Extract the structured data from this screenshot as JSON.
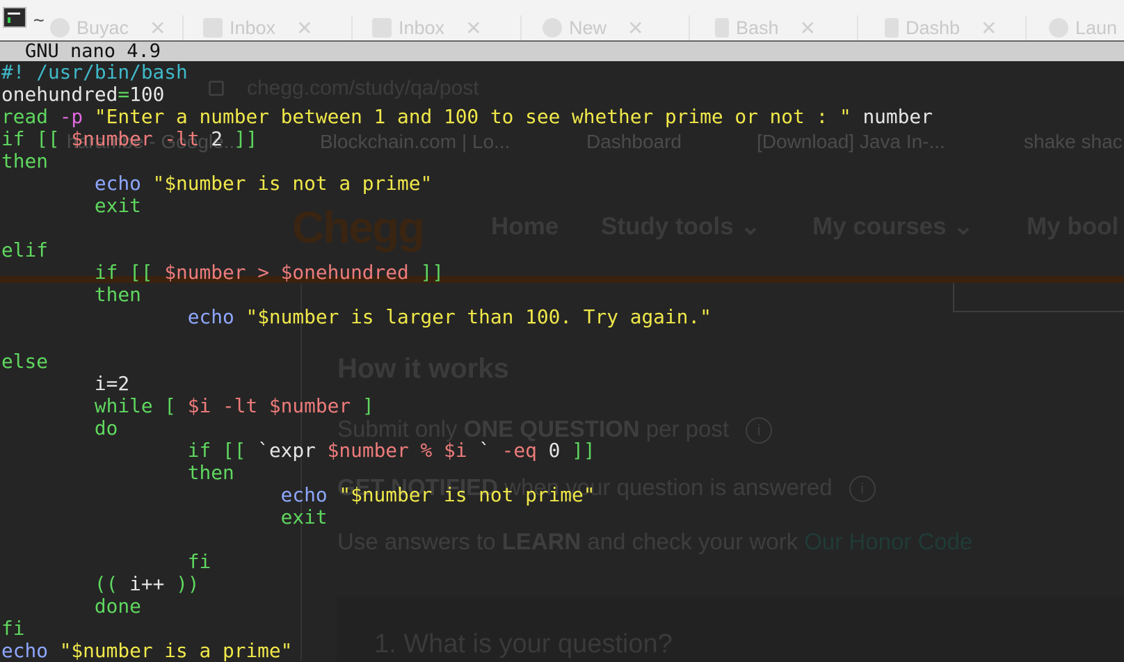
{
  "browser_ghost": {
    "tabs": [
      "Buyac",
      "Inbox",
      "Inbox",
      "New",
      "Bash",
      "Dashb",
      "Laun"
    ],
    "address": "chegg.com/study/qa/post",
    "bookmarks": [
      "harambe - Google...",
      "Blockchain.com | Lo...",
      "Dashboard",
      "[Download] Java In-...",
      "shake shac"
    ],
    "logo": "Chegg",
    "nav": [
      "Home",
      "Study tools",
      "My courses",
      "My bool"
    ],
    "section_title": "How it works",
    "bullets": {
      "b1_pre": "Submit only ",
      "b1_bold": "ONE QUESTION",
      "b1_post": " per post",
      "b2_bold": "GET NOTIFIED",
      "b2_post": " when your question is answered",
      "b3_pre": "Use answers to ",
      "b3_bold": "LEARN",
      "b3_post": " and check your work ",
      "b3_link": "Our Honor Code"
    },
    "question_heading": "1. What is your question?"
  },
  "terminal": {
    "tilde": "~",
    "header": "GNU nano 4.9"
  },
  "code": {
    "l1": "#! /usr/bin/bash",
    "l2a": "onehundred",
    "l2b": "=",
    "l2c": "100",
    "l3a": "read ",
    "l3b": "-p",
    "l3c": " \"Enter a number between 1 and 100 to see whether prime or not : \"",
    "l3d": " number",
    "l4a": "if [[ ",
    "l4b": "$number -lt",
    "l4c": " 2 ",
    "l4d": "]]",
    "l5": "then",
    "l6indent": "        ",
    "l6a": "echo",
    "l6b": " \"$number is not a prime\"",
    "l7indent": "        ",
    "l7": "exit",
    "l9": "elif",
    "l10indent": "        ",
    "l10a": "if [[ ",
    "l10b": "$number > $onehundred",
    "l10c": " ]]",
    "l11indent": "        ",
    "l11": "then",
    "l12indent": "                ",
    "l12a": "echo",
    "l12b": " \"$number is larger than 100. Try again.\"",
    "l14": "else",
    "l15indent": "        ",
    "l15a": "i",
    "l15b": "=2",
    "l16indent": "        ",
    "l16a": "while [ ",
    "l16b": "$i -lt $number",
    "l16c": " ]",
    "l17indent": "        ",
    "l17": "do",
    "l18indent": "                ",
    "l18a": "if [[ ",
    "l18b": "`",
    "l18c": "expr ",
    "l18d": "$number % $i",
    "l18e": " ` ",
    "l18f": "-eq",
    "l18g": " 0 ",
    "l18h": "]]",
    "l19indent": "                ",
    "l19": "then",
    "l20indent": "                        ",
    "l20a": "echo",
    "l20b": " \"$number is not prime\"",
    "l21indent": "                        ",
    "l21": "exit",
    "l23indent": "                ",
    "l23": "fi",
    "l24indent": "        ",
    "l24a": "((",
    "l24b": " i++ ",
    "l24c": "))",
    "l25indent": "        ",
    "l25": "done",
    "l26": "fi",
    "l27a": "echo",
    "l27b": " \"$number is a prime\""
  }
}
